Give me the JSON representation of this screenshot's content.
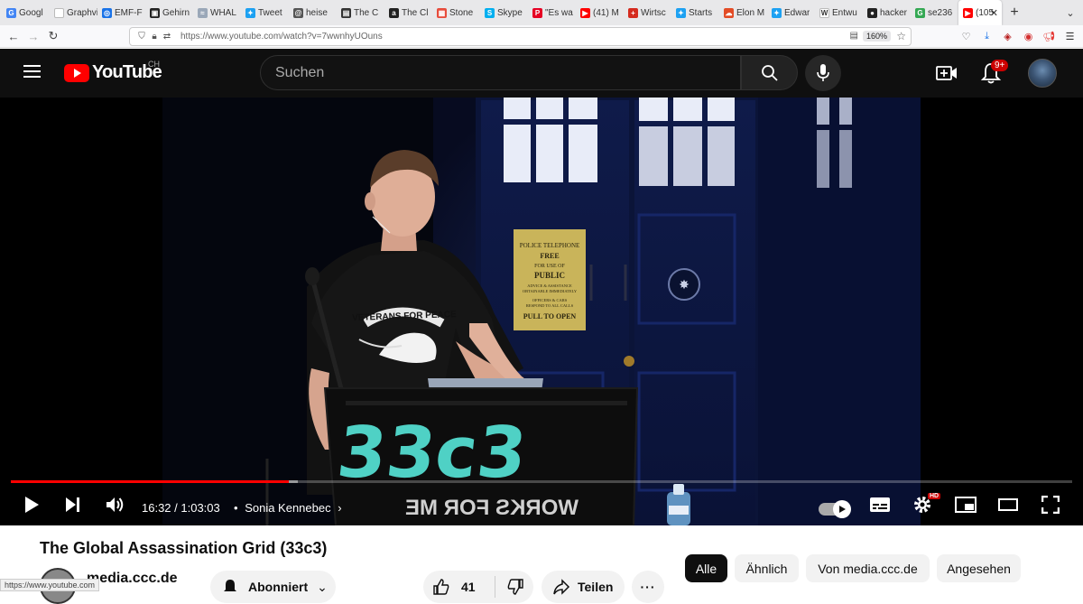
{
  "browser": {
    "tabs": [
      {
        "title": "Googl",
        "color": "#4285f4",
        "glyph": "G"
      },
      {
        "title": "Graphviz",
        "color": "#ffffff",
        "glyph": ""
      },
      {
        "title": "EMF-F",
        "color": "#1a73e8",
        "glyph": "◎"
      },
      {
        "title": "Gehirn",
        "color": "#222222",
        "glyph": "▣"
      },
      {
        "title": "WHAL",
        "color": "#9aa7b8",
        "glyph": "≈"
      },
      {
        "title": "Tweet",
        "color": "#1da1f2",
        "glyph": "✦"
      },
      {
        "title": "heise",
        "color": "#555555",
        "glyph": "@"
      },
      {
        "title": "The C",
        "color": "#333333",
        "glyph": "▤"
      },
      {
        "title": "The Cl",
        "color": "#222222",
        "glyph": "a"
      },
      {
        "title": "Stone",
        "color": "#e74c3c",
        "glyph": "▦"
      },
      {
        "title": "Skype",
        "color": "#00aff0",
        "glyph": "S"
      },
      {
        "title": "\"Es wa",
        "color": "#e60023",
        "glyph": "P"
      },
      {
        "title": "(41) M",
        "color": "#ff0000",
        "glyph": "▶"
      },
      {
        "title": "Wirtsc",
        "color": "#d52b1e",
        "glyph": "+"
      },
      {
        "title": "Starts",
        "color": "#1da1f2",
        "glyph": "✦"
      },
      {
        "title": "Elon M",
        "color": "#e34c26",
        "glyph": "☁"
      },
      {
        "title": "Edwar",
        "color": "#1da1f2",
        "glyph": "✦"
      },
      {
        "title": "Entwu",
        "color": "#ffffff",
        "glyph": "W"
      },
      {
        "title": "hacker",
        "color": "#222222",
        "glyph": "●"
      },
      {
        "title": "se236",
        "color": "#34a853",
        "glyph": "G"
      }
    ],
    "active_tab": {
      "title": "(105",
      "color": "#ff0000"
    },
    "url": "https://www.youtube.com/watch?v=7wwnhyUOuns",
    "zoom": "160%",
    "status_url": "https://www.youtube.com"
  },
  "youtube": {
    "logo_text": "YouTube",
    "region": "CH",
    "search_placeholder": "Suchen",
    "notification_count": "9+"
  },
  "player": {
    "current_time": "16:32 / 1:03:03",
    "separator": "•",
    "chapter": "Sonia Kennebec",
    "progress_fraction": 0.262,
    "buffered_fraction": 0.27,
    "hd_badge": "HD",
    "scene": {
      "sign_lines": [
        "POLICE TELEPHONE",
        "FREE",
        "FOR USE OF",
        "PUBLIC",
        "ADVICE & ASSISTANCE",
        "OBTAINABLE IMMEDIATELY",
        "OFFICERS & CARS",
        "RESPOND TO ALL CALLS",
        "PULL TO OPEN"
      ],
      "shirt_text": "VETERANS FOR PEACE",
      "lectern_logo": "33c3",
      "lectern_motto": "WORKS FOR ME"
    }
  },
  "video": {
    "title": "The Global Assassination Grid (33c3)",
    "channel": "media.ccc.de",
    "subscribe_label": "Abonniert",
    "likes": "41",
    "share_label": "Teilen"
  },
  "chips": [
    "Alle",
    "Ähnlich",
    "Von media.ccc.de",
    "Angesehen"
  ]
}
